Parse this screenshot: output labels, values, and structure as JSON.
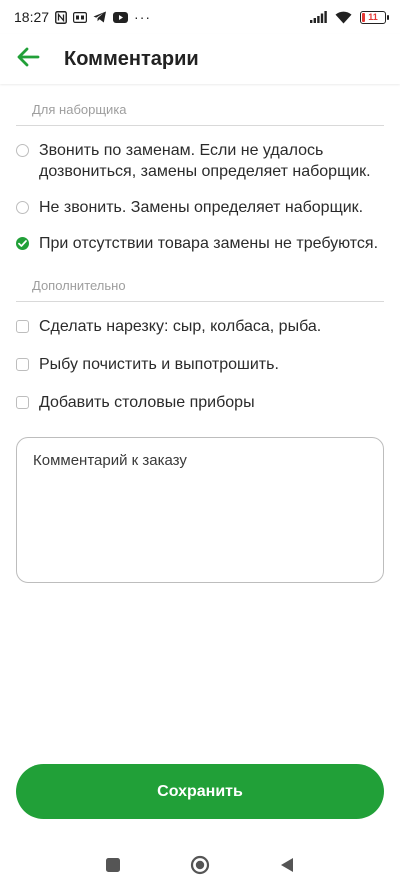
{
  "status_bar": {
    "time": "18:27",
    "battery_level": "11",
    "icons": [
      "nfc-icon",
      "hd-icon",
      "telegram-icon",
      "youtube-icon",
      "more-dots-icon",
      "signal-icon",
      "wifi-icon",
      "battery-icon"
    ],
    "more_dots": "···"
  },
  "app_bar": {
    "title": "Комментарии",
    "back_icon": "arrow-left-icon"
  },
  "colors": {
    "accent": "#21a038",
    "battery_low": "#e53935"
  },
  "picker_section": {
    "header": "Для наборщика",
    "options": [
      {
        "label": "Звонить по заменам. Если не удалось дозвониться, замены определяет наборщик.",
        "selected": false
      },
      {
        "label": "Не звонить. Замены определяет наборщик.",
        "selected": false
      },
      {
        "label": "При отсутствии товара замены не требуются.",
        "selected": true
      }
    ]
  },
  "extra_section": {
    "header": "Дополнительно",
    "options": [
      {
        "label": "Сделать нарезку: сыр, колбаса, рыба.",
        "checked": false
      },
      {
        "label": "Рыбу почистить и выпотрошить.",
        "checked": false
      },
      {
        "label": "Добавить столовые приборы",
        "checked": false
      }
    ]
  },
  "comment": {
    "placeholder": "Комментарий к заказу",
    "value": ""
  },
  "save_button": {
    "label": "Сохранить"
  }
}
